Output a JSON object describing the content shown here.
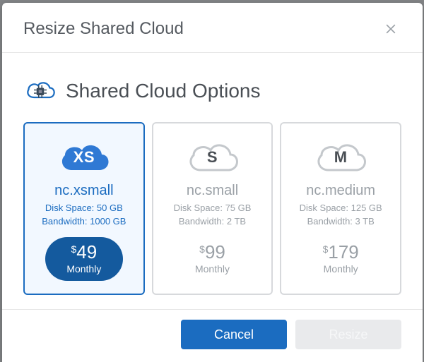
{
  "modal": {
    "title": "Resize Shared Cloud",
    "section_title": "Shared Cloud Options"
  },
  "options": [
    {
      "code": "XS",
      "name": "nc.xsmall",
      "disk_label": "Disk Space: 50 GB",
      "bandwidth_label": "Bandwidth: 1000 GB",
      "currency": "$",
      "price": "49",
      "interval": "Monthly",
      "selected": true
    },
    {
      "code": "S",
      "name": "nc.small",
      "disk_label": "Disk Space: 75 GB",
      "bandwidth_label": "Bandwidth: 2 TB",
      "currency": "$",
      "price": "99",
      "interval": "Monthly",
      "selected": false
    },
    {
      "code": "M",
      "name": "nc.medium",
      "disk_label": "Disk Space: 125 GB",
      "bandwidth_label": "Bandwidth: 3 TB",
      "currency": "$",
      "price": "179",
      "interval": "Monthly",
      "selected": false
    }
  ],
  "footer": {
    "cancel": "Cancel",
    "resize": "Resize"
  },
  "colors": {
    "accent": "#1b6cc0",
    "muted": "#9aa0a6"
  }
}
